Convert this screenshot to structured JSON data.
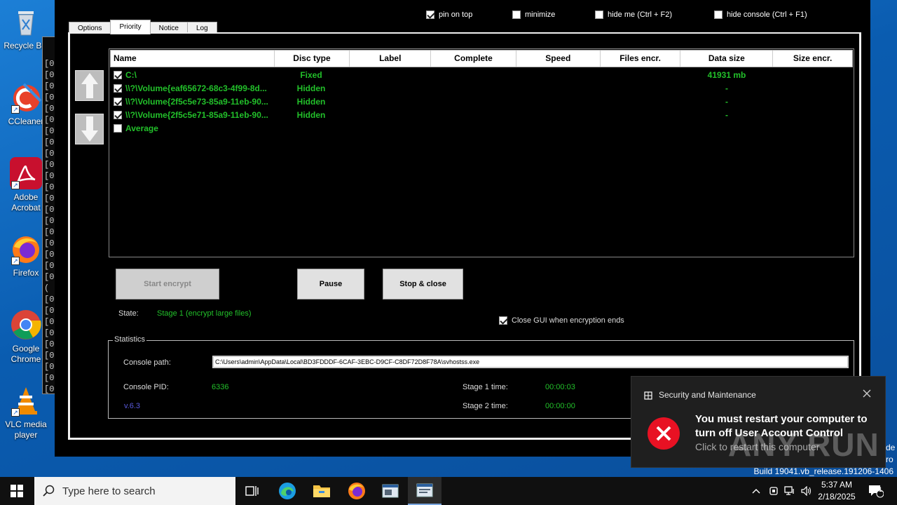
{
  "desktop_icons": [
    {
      "label": "Recycle Bin",
      "name": "recycle-bin-icon"
    },
    {
      "label": "CCleaner",
      "name": "ccleaner-icon"
    },
    {
      "label": "Adobe Acrobat",
      "name": "adobe-acrobat-icon"
    },
    {
      "label": "Firefox",
      "name": "firefox-icon"
    },
    {
      "label": "Google Chrome",
      "name": "chrome-icon"
    },
    {
      "label": "VLC media player",
      "name": "vlc-icon"
    }
  ],
  "console": {
    "lines": [
      "[0",
      "[0",
      "[0",
      "[0",
      "[0",
      "[0",
      "[0",
      "[0",
      "[0",
      "[0",
      "[0",
      "[0",
      "[0",
      "[0",
      "[0",
      "[0",
      "[0",
      "[0",
      "[0",
      "[0",
      "(",
      "[0",
      "[0",
      "[0",
      "[0",
      "[0",
      "[0",
      "[0",
      "[0",
      "[0"
    ]
  },
  "top_options": {
    "pin_on_top": {
      "label": "pin on top",
      "checked": true
    },
    "minimize": {
      "label": "minimize",
      "checked": false
    },
    "hide_me": {
      "label": "hide me (Ctrl + F2)",
      "checked": false
    },
    "hide_console": {
      "label": "hide console (Ctrl + F1)",
      "checked": false
    }
  },
  "tabs": [
    "Options",
    "Priority",
    "Notice",
    "Log"
  ],
  "active_tab": "Priority",
  "table": {
    "columns": [
      "Name",
      "Disc type",
      "Label",
      "Complete",
      "Speed",
      "Files encr.",
      "Data size",
      "Size encr."
    ],
    "rows": [
      {
        "checked": true,
        "name": "C:\\",
        "type": "Fixed",
        "label": "",
        "complete": "",
        "speed": "",
        "files": "",
        "data_size": "41931 mb",
        "size_encr": ""
      },
      {
        "checked": true,
        "name": "\\\\?\\Volume{eaf65672-68c3-4f99-8d...",
        "type": "Hidden",
        "label": "",
        "complete": "",
        "speed": "",
        "files": "",
        "data_size": "-",
        "size_encr": ""
      },
      {
        "checked": true,
        "name": "\\\\?\\Volume{2f5c5e73-85a9-11eb-90...",
        "type": "Hidden",
        "label": "",
        "complete": "",
        "speed": "",
        "files": "",
        "data_size": "-",
        "size_encr": ""
      },
      {
        "checked": true,
        "name": "\\\\?\\Volume{2f5c5e71-85a9-11eb-90...",
        "type": "Hidden",
        "label": "",
        "complete": "",
        "speed": "",
        "files": "",
        "data_size": "-",
        "size_encr": ""
      },
      {
        "checked": false,
        "name": "Average",
        "type": "",
        "label": "",
        "complete": "",
        "speed": "",
        "files": "",
        "data_size": "",
        "size_encr": ""
      }
    ]
  },
  "buttons": {
    "start": "Start encrypt",
    "pause": "Pause",
    "stop": "Stop & close"
  },
  "state": {
    "label": "State:",
    "value": "Stage 1 (encrypt large files)"
  },
  "close_gui": {
    "label": "Close GUI when encryption ends",
    "checked": true
  },
  "statistics": {
    "title": "Statistics",
    "console_path_label": "Console path:",
    "console_path": "C:\\Users\\admin\\AppData\\Local\\BD3FDDDF-6CAF-3EBC-D9CF-C8DF72D8F78A\\svhostss.exe",
    "pid_label": "Console PID:",
    "pid": "6336",
    "version": "v.6.3",
    "stage1_label": "Stage 1 time:",
    "stage1": "00:00:03",
    "stage2_label": "Stage 2 time:",
    "stage2": "00:00:00"
  },
  "toast": {
    "app": "Security and Maintenance",
    "title": "You must restart your computer to turn off User Account Control",
    "body": "Click to restart this computer"
  },
  "watermark": "ANY RUN",
  "build": "Build 19041.vb_release.191206-1406",
  "edge_text": [
    "de",
    "ro"
  ],
  "taskbar": {
    "search_placeholder": "Type here to search",
    "time": "5:37 AM",
    "date": "2/18/2025",
    "notif_count": "1"
  },
  "colors": {
    "accent_green": "#22c02a",
    "toast_error": "#e81123",
    "desktop_blue": "#0a5cb0"
  }
}
